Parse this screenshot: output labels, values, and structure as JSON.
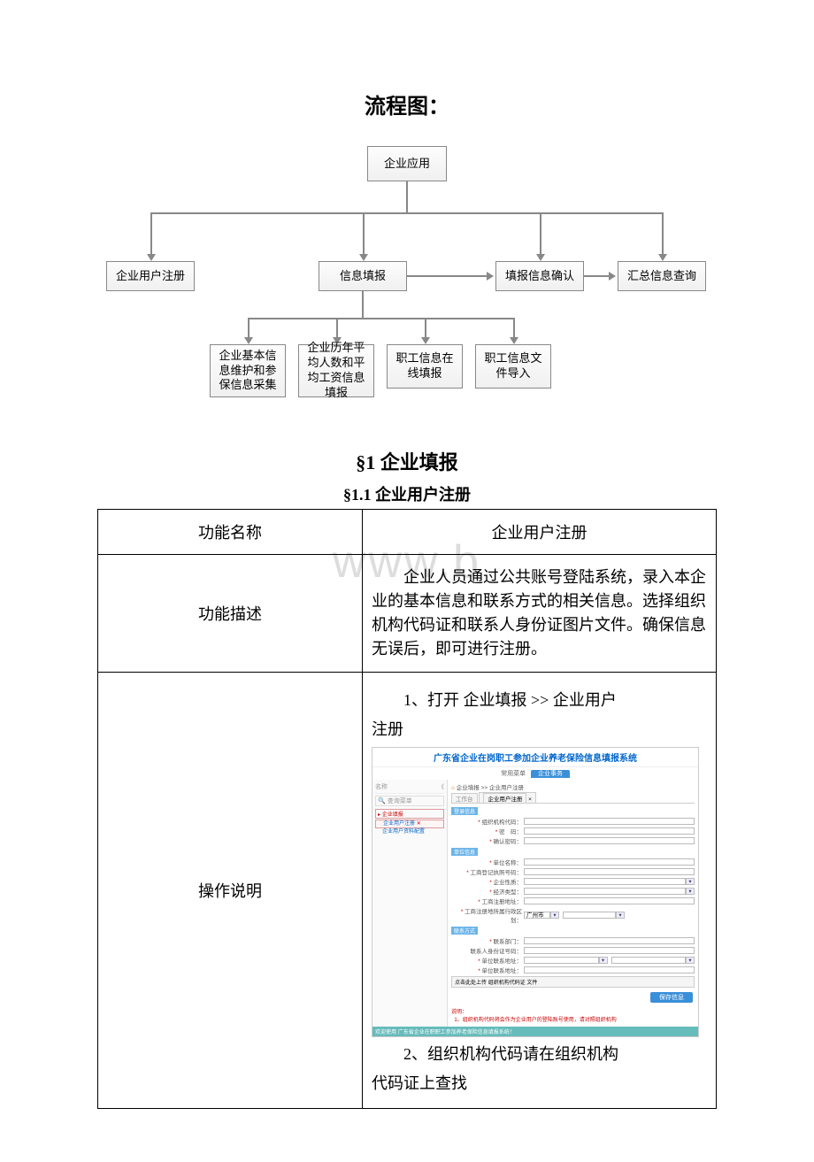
{
  "title": "流程图：",
  "watermark": "www.b",
  "flow": {
    "root": "企业应用",
    "level2": [
      "企业用户注册",
      "信息填报",
      "填报信息确认",
      "汇总信息查询"
    ],
    "level3": [
      "企业基本信息维护和参保信息采集",
      "企业历年平均人数和平均工资信息填报",
      "职工信息在线填报",
      "职工信息文件导入"
    ]
  },
  "section1": {
    "title": "§1 企业填报",
    "sub": "§1.1 企业用户注册"
  },
  "table": {
    "row1": {
      "label": "功能名称",
      "value": "企业用户注册"
    },
    "row2": {
      "label": "功能描述",
      "value": "　　企业人员通过公共账号登陆系统，录入本企业的基本信息和联系方式的相关信息。选择组织机构代码证和联系人身份证图片文件。确保信息无误后，即可进行注册。"
    },
    "row3": {
      "label": "操作说明",
      "step1_a": "1、打开 企业填报 >> 企业用户",
      "step1_b": "注册",
      "step2_a": "2、组织机构代码请在组织机构",
      "step2_b": "代码证上查找"
    }
  },
  "screenshot": {
    "sysTitle": "广东省企业在岗职工参加企业养老保险信息填报系统",
    "menu": {
      "left": "常用菜单",
      "active": "企业事务"
    },
    "leftPanel": {
      "nameLabel": "名称",
      "expandBtn": "《",
      "searchPH": "查询菜单",
      "tree": {
        "root": "企业填报",
        "item1": "企业用户注册",
        "item2": "企业用户资料配置",
        "badge": "✕"
      }
    },
    "breadcrumb": {
      "home": "⌂",
      "p1": "企业填报",
      "p2": "企业用户注册"
    },
    "workTabLabel": "工作台",
    "workTab": "企业用户注册",
    "sections": {
      "s1": "登录信息",
      "s2": "单位信息",
      "s3": "联系方式"
    },
    "fields": {
      "orgcode": "组织机构代码：",
      "pwd": "密　码：",
      "pwd2": "确认密码：",
      "unitName": "单位名称：",
      "regNo": "工商登记执照号码：",
      "unitNature": "企业性质：",
      "econType": "经济类型：",
      "regAddr": "工商注册地址：",
      "regCity": "工商注册地所属行政区划：",
      "regCityVal": "广州市",
      "dept": "联系部门：",
      "idno": "联系人身份证号码：",
      "contactAddr": "单位联系地址：",
      "contactAddr2": "单位联系地址："
    },
    "uploadBtn": "点击此处上传 组织机构代码证 文件",
    "submitBtn": "保存信息",
    "note": {
      "t": "说明：",
      "c": "1、组织机构代码将会作为企业用户的登陆账号使用，请对照组织机构"
    },
    "footer": "欢迎使用 广东省企业在职职工参加养老保险信息填报系统！"
  }
}
